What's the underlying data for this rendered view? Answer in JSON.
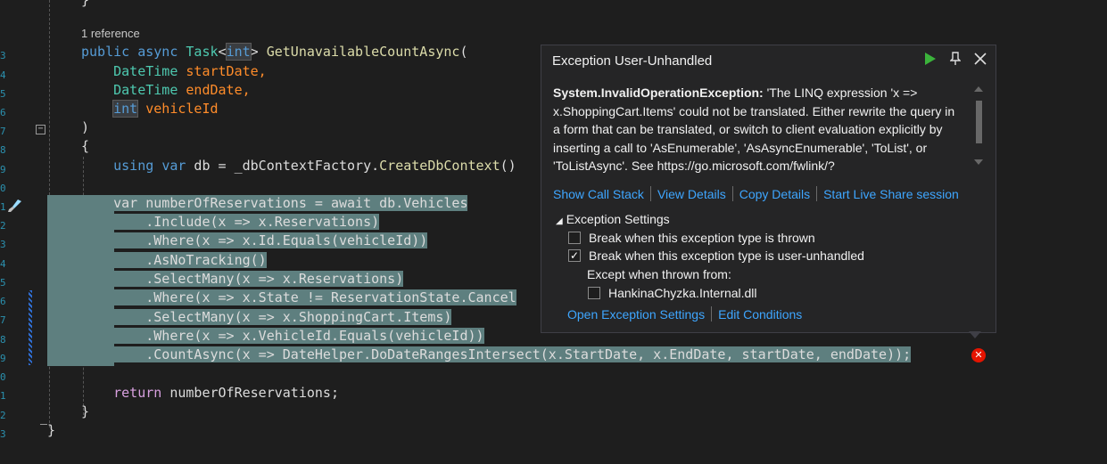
{
  "gutter": {
    "numbers": [
      "3",
      "4",
      "5",
      "6",
      "7",
      "8",
      "9",
      "0",
      "1",
      "2",
      "3",
      "4",
      "5",
      "6",
      "7",
      "8",
      "9",
      "0",
      "1",
      "2",
      "3"
    ]
  },
  "codelens": "1 reference",
  "code": {
    "line_sig_kw1": "public",
    "line_sig_kw2": "async",
    "line_sig_task": "Task",
    "line_sig_int": "int",
    "line_sig_method": "GetUnavailableCountAsync",
    "line_sig_open": "(",
    "param1_type": "DateTime",
    "param1_name": "startDate,",
    "param2_type": "DateTime",
    "param2_name": "endDate,",
    "param3_type": "int",
    "param3_name": "vehicleId",
    "close_paren": ")",
    "open_brace": "{",
    "using_line_kw1": "using",
    "using_line_kw2": "var",
    "using_line_rest": " db = _dbContextFactory.",
    "using_line_method": "CreateDbContext",
    "using_line_end": "()",
    "q1": "var numberOfReservations = await db.Vehicles",
    "q2": "    .Include(x => x.Reservations)",
    "q3": "    .Where(x => x.Id.Equals(vehicleId))",
    "q4": "    .AsNoTracking()",
    "q5": "    .SelectMany(x => x.Reservations)",
    "q6": "    .Where(x => x.State != ReservationState.Cancel",
    "q7": "    .SelectMany(x => x.ShoppingCart.Items)",
    "q8": "    .Where(x => x.VehicleId.Equals(vehicleId))",
    "q9": "    .CountAsync(x => DateHelper.DoDateRangesIntersect(x.StartDate, x.EndDate, startDate, endDate));",
    "ret_kw": "return",
    "ret_rest": " numberOfReservations;",
    "close_brace_inner": "}",
    "close_brace_outer": "}"
  },
  "dialog": {
    "title": "Exception User-Unhandled",
    "exception_type": "System.InvalidOperationException:",
    "message": " 'The LINQ expression 'x => x.ShoppingCart.Items' could not be translated. Either rewrite the query in a form that can be translated, or switch to client evaluation explicitly by inserting a call to 'AsEnumerable', 'AsAsyncEnumerable', 'ToList', or 'ToListAsync'. See https://go.microsoft.com/fwlink/?",
    "links": [
      "Show Call Stack",
      "View Details",
      "Copy Details",
      "Start Live Share session"
    ],
    "settings_header": "Exception Settings",
    "cb1_label": "Break when this exception type is thrown",
    "cb1_checked": false,
    "cb2_label": "Break when this exception type is user-unhandled",
    "cb2_checked": true,
    "except_label": "Except when thrown from:",
    "cb3_label": "HankinaChyzka.Internal.dll",
    "cb3_checked": false,
    "bottom_links": [
      "Open Exception Settings",
      "Edit Conditions"
    ]
  },
  "icons": {
    "continue": "play-icon",
    "pin": "pin-icon",
    "close": "close-icon",
    "error": "error-icon",
    "brush": "brush-icon"
  },
  "colors": {
    "link": "#3ea6ff",
    "highlight": "#5e7f7f",
    "error": "#e51400",
    "play": "#3bb33b"
  }
}
